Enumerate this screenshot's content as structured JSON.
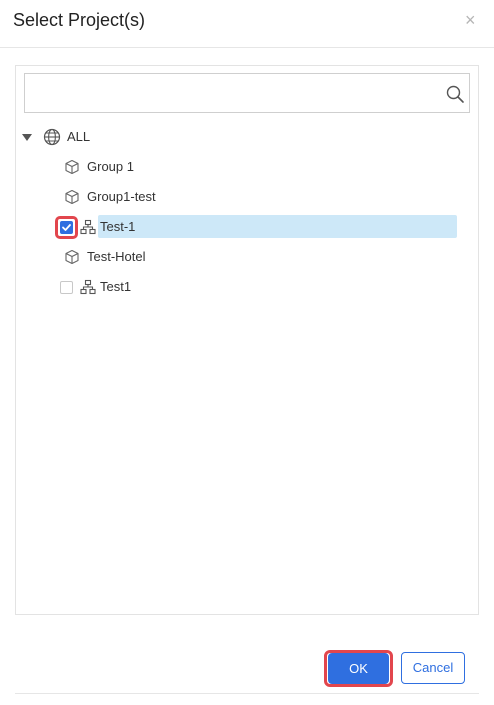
{
  "dialog": {
    "title": "Select Project(s)",
    "close_glyph": "×"
  },
  "search": {
    "value": "",
    "placeholder": "",
    "icon": "search-icon"
  },
  "tree": {
    "root": {
      "label": "ALL",
      "icon": "globe-icon",
      "expanded": true
    },
    "items": [
      {
        "label": "Group 1",
        "icon": "cube-icon",
        "checkbox": false,
        "checked": false,
        "selected": false
      },
      {
        "label": "Group1-test",
        "icon": "cube-icon",
        "checkbox": false,
        "checked": false,
        "selected": false
      },
      {
        "label": "Test-1",
        "icon": "network-icon",
        "checkbox": true,
        "checked": true,
        "selected": true
      },
      {
        "label": "Test-Hotel",
        "icon": "cube-icon",
        "checkbox": false,
        "checked": false,
        "selected": false
      },
      {
        "label": "Test1",
        "icon": "network-icon",
        "checkbox": true,
        "checked": false,
        "selected": false
      }
    ]
  },
  "footer": {
    "ok_label": "OK",
    "cancel_label": "Cancel"
  },
  "colors": {
    "accent": "#2f6fe0",
    "selection": "#cde8f8",
    "highlight": "#e2464d"
  }
}
